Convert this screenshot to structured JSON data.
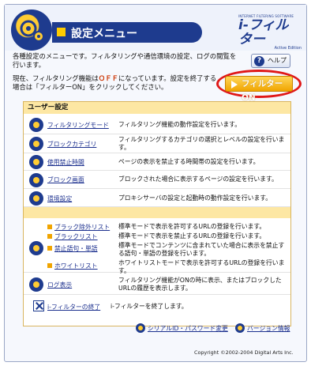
{
  "header": {
    "title": "設定メニュー",
    "brand_small": "INTERNET FILTERING SOFTWARE",
    "brand_name": "i-フィルター",
    "brand_edition": "Active Edition"
  },
  "intro_text": "各種設定のメニューです。フィルタリングや通信環境の設定、ログの閲覧を行います。",
  "help_label": "ヘルプ",
  "status": {
    "prefix": "現在、フィルタリング機能は",
    "state": "ＯＦＦ",
    "suffix": "になっています。設定を終了する場合は「フィルターON」をクリックしてください。"
  },
  "filter_on_label": "フィルターON",
  "user_settings": {
    "heading": "ユーザー設定",
    "items": [
      {
        "label": "フィルタリングモード",
        "desc": "フィルタリング機能の動作設定を行います。"
      },
      {
        "label": "ブロックカテゴリ",
        "desc": "フィルタリングするカテゴリの選択とレベルの設定を行います。"
      },
      {
        "label": "使用禁止時間",
        "desc": "ページの表示を禁止する時間帯の設定を行います。"
      },
      {
        "label": "ブロック画面",
        "desc": "ブロックされた場合に表示するページの設定を行います。"
      },
      {
        "label": "環境設定",
        "desc": "プロキシサーバの設定と起動時の動作設定を行います。"
      }
    ]
  },
  "lists": [
    {
      "label": "ブラック除外リスト",
      "desc": "標準モードで表示を許可するURLの登録を行います。"
    },
    {
      "label": "ブラックリスト",
      "desc": "標準モードで表示を禁止するURLの登録を行います。"
    },
    {
      "label": "禁止語句・単語",
      "desc": "標準モードでコンテンツに含まれていた場合に表示を禁止する語句・単語の登録を行います。"
    },
    {
      "label": "ホワイトリスト",
      "desc": "ホワイトリストモードで表示を許可するURLの登録を行います。"
    }
  ],
  "log": {
    "label": "ログ表示",
    "desc": "フィルタリング機能がONの時に表示、またはブロックしたURLの履歴を表示します。"
  },
  "exit": {
    "label": "i-フィルターの終了",
    "desc": "i-フィルターを終了します。"
  },
  "footer": {
    "serial_label": "シリアルID・パスワード変更",
    "version_label": "バージョン情報",
    "copyright": "Copyright ©2002-2004 Digital Arts Inc."
  }
}
